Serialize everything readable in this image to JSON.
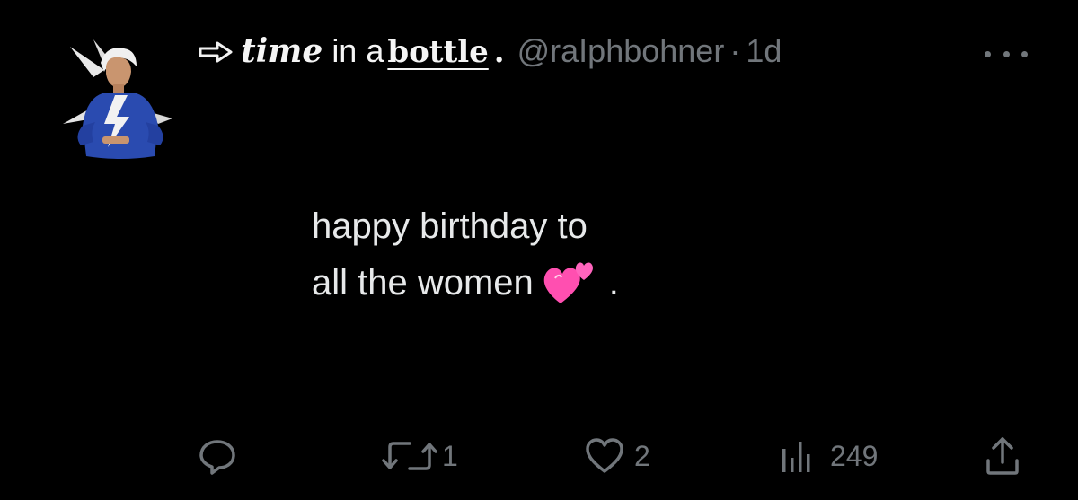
{
  "tweet": {
    "display_name_part1": "time",
    "display_name_part2": "in a",
    "display_name_part3": "bottle",
    "display_name_part4": ".",
    "handle": "@raIphbohner",
    "separator": "·",
    "time": "1d",
    "text_line1": "happy birthday to",
    "text_line2": "all the women",
    "text_trailing": ".",
    "emoji": "two-hearts",
    "icons": {
      "name_prefix": "arrow-right-outline-icon",
      "more": "more-dots-icon",
      "reply": "reply-icon",
      "retweet": "retweet-icon",
      "like": "heart-icon",
      "views": "views-icon",
      "share": "share-icon"
    }
  },
  "actions": {
    "reply_count": "",
    "retweet_count": "1",
    "like_count": "2",
    "views_count": "249"
  },
  "colors": {
    "background": "#000000",
    "text": "#e7e9ea",
    "muted": "#71767b",
    "avatar_blue": "#2a4bb0",
    "emoji_pink": "#ff4fb0"
  }
}
